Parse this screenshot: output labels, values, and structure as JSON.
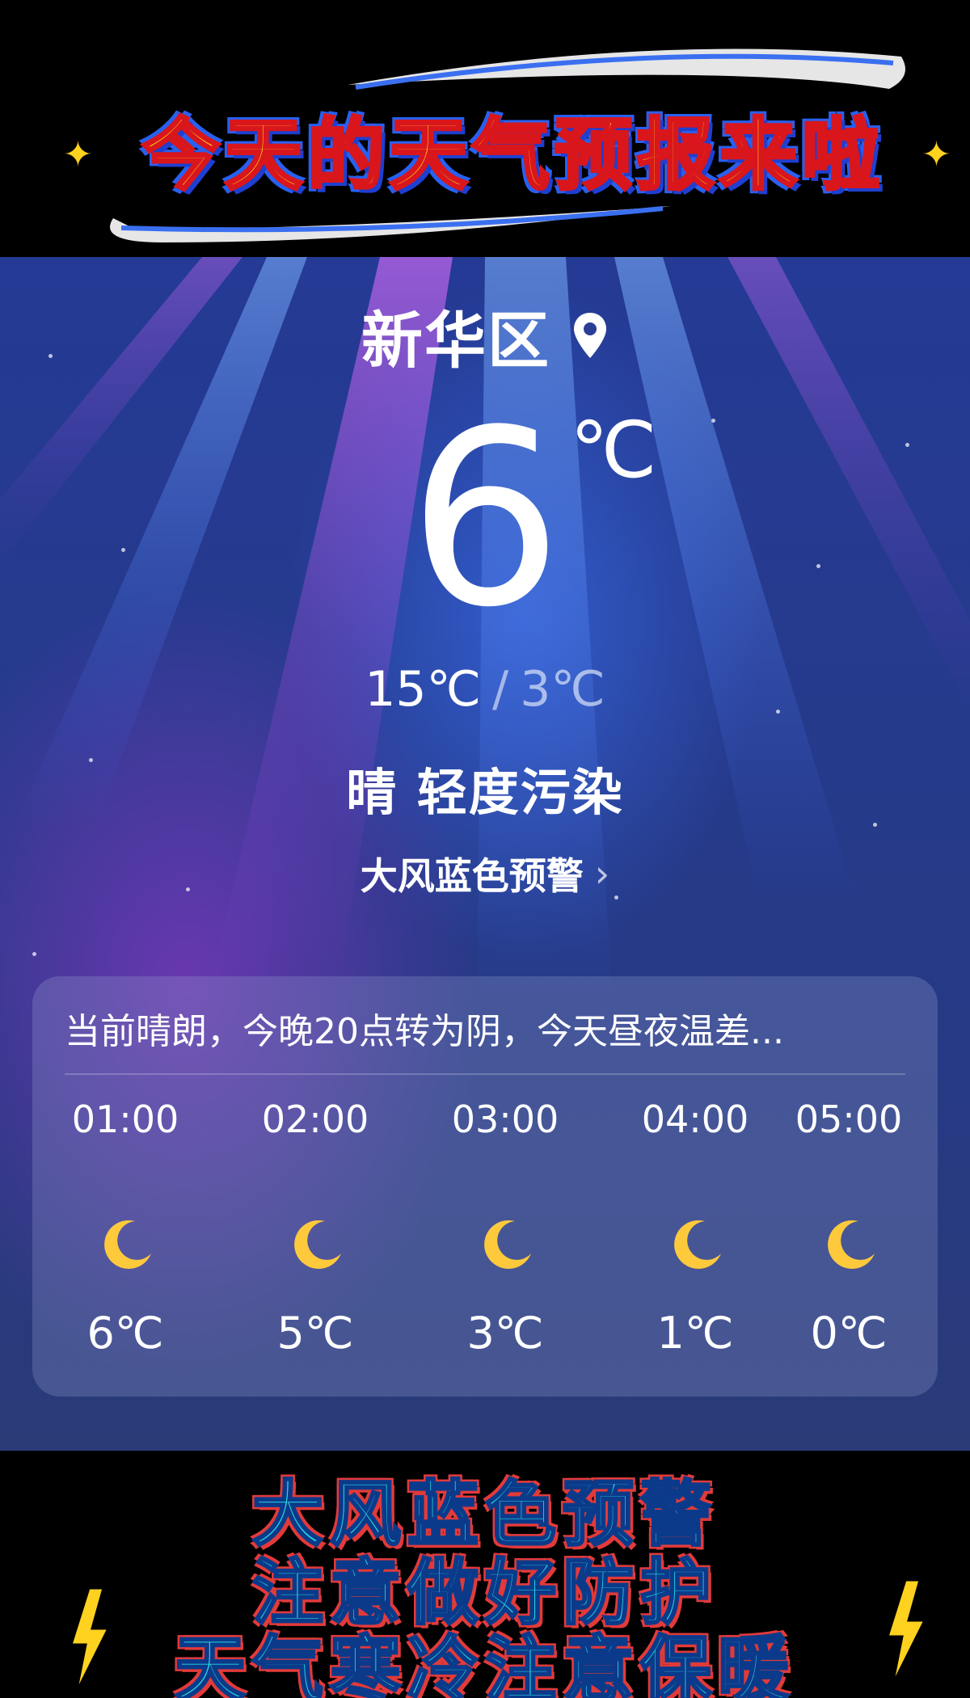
{
  "top_banner": {
    "title": "今天的天气预报来啦"
  },
  "weather": {
    "location": "新华区",
    "current_temp": "6",
    "temp_unit": "℃",
    "high": "15℃",
    "separator": "/",
    "low": "3℃",
    "condition": "晴  轻度污染",
    "alert": "大风蓝色预警",
    "forecast_summary": "当前晴朗，今晚20点转为阴，今天昼夜温差...",
    "hourly": [
      {
        "time": "01:00",
        "icon": "moon-icon",
        "temp": "6℃"
      },
      {
        "time": "02:00",
        "icon": "moon-icon",
        "temp": "5℃"
      },
      {
        "time": "03:00",
        "icon": "moon-icon",
        "temp": "3℃"
      },
      {
        "time": "04:00",
        "icon": "moon-icon",
        "temp": "1℃"
      },
      {
        "time": "05:00",
        "icon": "moon-icon",
        "temp": "0℃"
      }
    ]
  },
  "bottom_banner": {
    "line1": "大风蓝色预警",
    "line2": "注意做好防护",
    "line3": "天气寒冷注意保暖"
  },
  "colors": {
    "banner_title_fill": "#ffd21f",
    "banner_title_stroke": "#d8161c",
    "bottom_text_fill": "#27d8e8",
    "bottom_text_outline": "#e23a3a",
    "moon": "#ffc93c"
  }
}
